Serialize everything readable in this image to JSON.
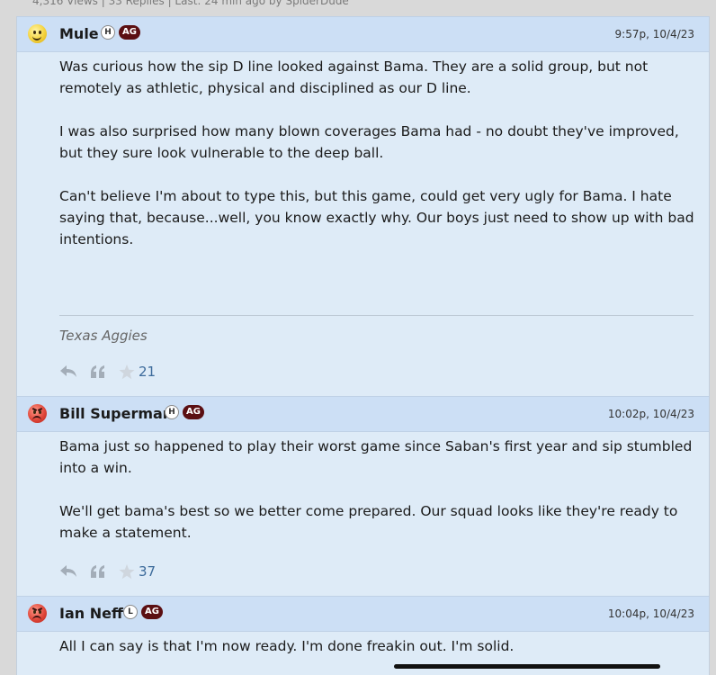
{
  "thread": {
    "stats": "4,316 Views | 33 Replies | Last: 24 min ago by SpiderDude"
  },
  "posts": [
    {
      "username": "Mule",
      "role_badge": "H",
      "school_badge": "AG",
      "timestamp": "9:57p, 10/4/23",
      "paragraphs": [
        "Was curious how the sip D line looked against Bama. They are a solid group, but not remotely as athletic, physical and disciplined as our D line.",
        "I was also surprised how many blown coverages Bama had - no doubt they've improved, but they sure look vulnerable to the deep ball.",
        "Can't believe I'm about to type this, but this game, could get very ugly for Bama. I hate saying that, because...well, you know exactly why. Our boys just need to show up with bad intentions."
      ],
      "signature": "Texas Aggies",
      "star_count": "21",
      "avatar": "happy-smiley-icon"
    },
    {
      "username": "Bill Superman",
      "role_badge": "H",
      "school_badge": "AG",
      "timestamp": "10:02p, 10/4/23",
      "paragraphs": [
        "Bama just so happened to play their worst game since Saban's first year and sip stumbled into a win.",
        "We'll get bama's best so we better come prepared. Our squad looks like they're ready to make a statement."
      ],
      "star_count": "37",
      "avatar": "angry-smiley-icon"
    },
    {
      "username": "Ian Neff",
      "role_badge": "L",
      "school_badge": "AG",
      "timestamp": "10:04p, 10/4/23",
      "paragraphs": [
        "All I can say is that I'm now ready. I'm done freakin out. I'm solid."
      ],
      "avatar": "angry-smiley-icon"
    }
  ],
  "colors": {
    "post_background": "#deebf7",
    "header_background": "#ccdff5",
    "ag_badge": "#5b0f12",
    "star_count": "#3d6b9b"
  }
}
